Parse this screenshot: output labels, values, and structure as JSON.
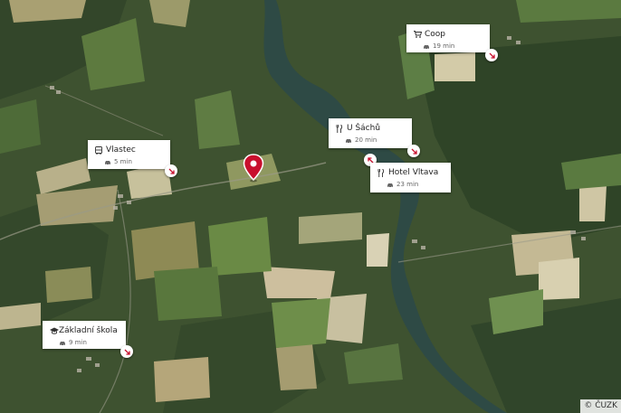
{
  "map": {
    "copyright": "© ČUZK",
    "colors": {
      "card_bg": "#ffffff",
      "marker": "#c8102e",
      "arrow": "#c8102e",
      "water": "#2e4a45"
    }
  },
  "pois": [
    {
      "name": "Coop",
      "icon": "cart-icon",
      "time": "19 min"
    },
    {
      "name": "U Šáchů",
      "icon": "restaurant-icon",
      "time": "20 min"
    },
    {
      "name": "Hotel Vltava",
      "icon": "restaurant-icon",
      "time": "23 min"
    },
    {
      "name": "Vlastec",
      "icon": "bus-icon",
      "time": "5 min"
    },
    {
      "name": "Základní škola Zá...",
      "icon": "school-icon",
      "time": "9 min"
    }
  ]
}
